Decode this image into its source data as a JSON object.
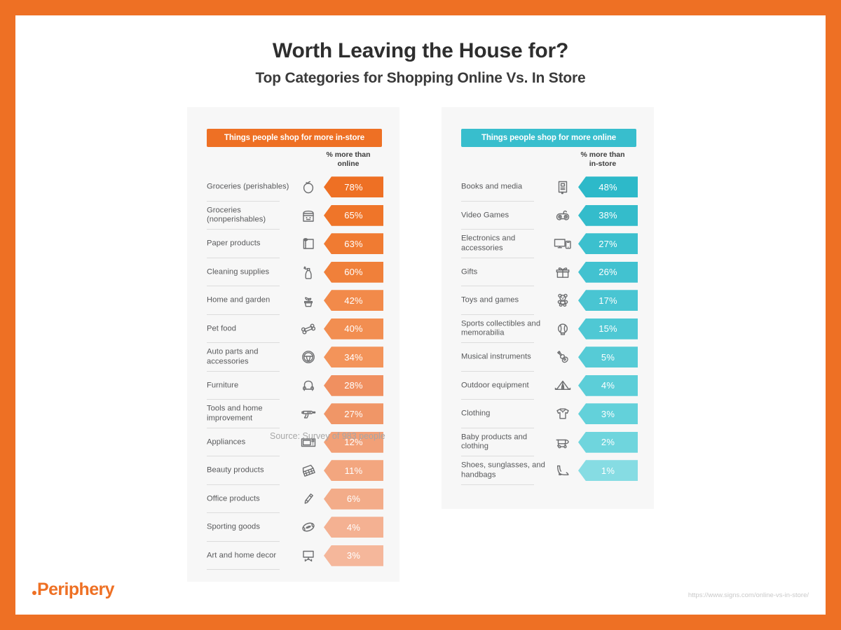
{
  "header": {
    "title": "Worth Leaving the House for?",
    "subtitle": "Top Categories for Shopping Online Vs. In Store"
  },
  "colors": {
    "frame_orange": "#EE7024",
    "accent_orange": "#EE7024",
    "accent_teal": "#38BECD",
    "panel_background": "#F7F7F7",
    "label_gray": "#58595B"
  },
  "panels": {
    "instore": {
      "header_label": "Things people shop for more in-store",
      "column_caption": "% more than\nonline"
    },
    "online": {
      "header_label": "Things people shop for more online",
      "column_caption": "% more than\nin-store"
    }
  },
  "source": "Source: Survey of 983 people",
  "footer": {
    "logo_text": "Periphery",
    "url": "https://www.signs.com/online-vs-in-store/"
  },
  "chart_data": [
    {
      "type": "bar",
      "title": "Things people shop for more in-store",
      "xlabel": "% more than online",
      "ylabel": "",
      "orientation": "horizontal",
      "color": "#EE7024",
      "legend": "none",
      "grid": false,
      "xlim": [
        0,
        78
      ],
      "categories": [
        "Groceries (perishables)",
        "Groceries (nonperishables)",
        "Paper products",
        "Cleaning supplies",
        "Home and garden",
        "Pet food",
        "Auto parts and accessories",
        "Furniture",
        "Tools and home improvement",
        "Appliances",
        "Beauty products",
        "Office products",
        "Sporting goods",
        "Art and home decor"
      ],
      "values": [
        78,
        65,
        63,
        60,
        42,
        40,
        34,
        28,
        27,
        12,
        11,
        6,
        4,
        3
      ],
      "value_labels": [
        "78%",
        "65%",
        "63%",
        "60%",
        "42%",
        "40%",
        "34%",
        "28%",
        "27%",
        "12%",
        "11%",
        "6%",
        "4%",
        "3%"
      ],
      "icons": [
        "apple-icon",
        "jar-icon",
        "paper-towel-roll-icon",
        "spray-bottle-icon",
        "potted-plant-icon",
        "dog-bone-icon",
        "steering-wheel-icon",
        "armchair-icon",
        "power-drill-icon",
        "microwave-icon",
        "makeup-palette-icon",
        "pencil-icon",
        "football-icon",
        "easel-icon"
      ],
      "bar_colors": [
        "#EE7024",
        "#EF7529",
        "#F07B32",
        "#F0803A",
        "#F28A4A",
        "#F28E51",
        "#F3945A",
        "#F09060",
        "#F09667",
        "#F2A077",
        "#F3A67F",
        "#F3AC89",
        "#F4B192",
        "#F5B79B"
      ]
    },
    {
      "type": "bar",
      "title": "Things people shop for more online",
      "xlabel": "% more than in-store",
      "ylabel": "",
      "orientation": "horizontal",
      "color": "#38BECD",
      "legend": "none",
      "grid": false,
      "xlim": [
        0,
        48
      ],
      "categories": [
        "Books and media",
        "Video Games",
        "Electronics and accessories",
        "Gifts",
        "Toys and games",
        "Sports collectibles and memorabilia",
        "Musical instruments",
        "Outdoor equipment",
        "Clothing",
        "Baby products and clothing",
        "Shoes, sunglasses, and handbags"
      ],
      "values": [
        48,
        38,
        27,
        26,
        17,
        15,
        5,
        4,
        3,
        2,
        1
      ],
      "value_labels": [
        "48%",
        "38%",
        "27%",
        "26%",
        "17%",
        "15%",
        "5%",
        "4%",
        "3%",
        "2%",
        "1%"
      ],
      "icons": [
        "book-icon",
        "game-controller-icon",
        "monitor-phone-icon",
        "gift-box-icon",
        "teddy-bear-icon",
        "baseball-icon",
        "guitar-icon",
        "tent-icon",
        "tshirt-icon",
        "stroller-icon",
        "high-heel-shoe-icon"
      ],
      "bar_colors": [
        "#2DB9C9",
        "#34BCCB",
        "#3CC0CE",
        "#42C2D0",
        "#49C5D2",
        "#4FC8D4",
        "#56CBD6",
        "#5CCED8",
        "#63D1DA",
        "#6FD5DD",
        "#86DCE3"
      ]
    }
  ]
}
